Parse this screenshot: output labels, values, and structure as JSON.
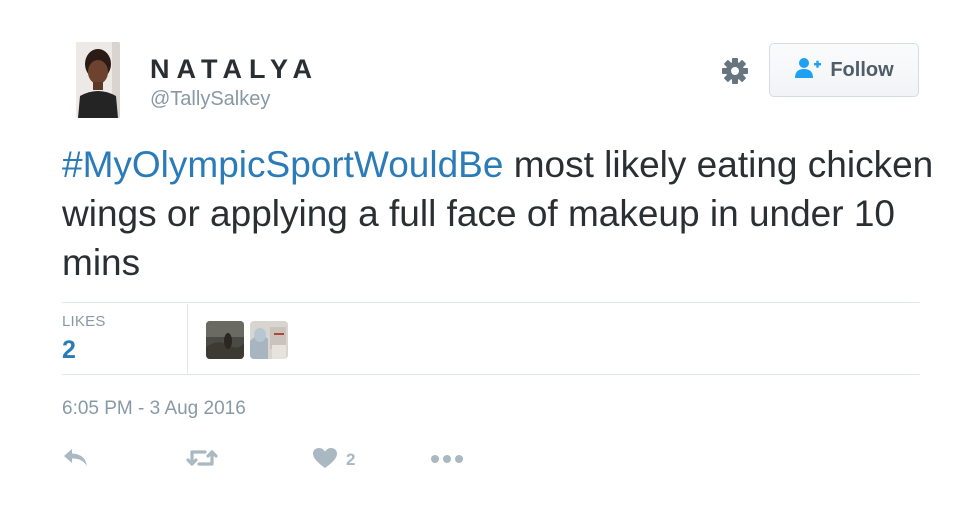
{
  "user": {
    "display_name": "NATALYA",
    "handle": "@TallySalkey"
  },
  "header": {
    "follow_label": "Follow",
    "settings_icon": "gear-icon",
    "follow_icon": "user-plus-icon"
  },
  "tweet": {
    "hashtag": "#MyOlympicSportWouldBe",
    "text": " most likely eating chicken wings or applying a full face of makeup in under 10 mins"
  },
  "stats": {
    "likes_label": "LIKES",
    "likes_count": "2"
  },
  "timestamp": "6:05 PM - 3 Aug 2016",
  "actions": {
    "reply_icon": "reply-icon",
    "retweet_icon": "retweet-icon",
    "like_icon": "heart-icon",
    "like_count": "2",
    "more_icon": "more-icon"
  },
  "colors": {
    "link": "#2b7bb9",
    "text": "#292f33",
    "muted": "#8899a6",
    "icon": "#aab8c2"
  }
}
